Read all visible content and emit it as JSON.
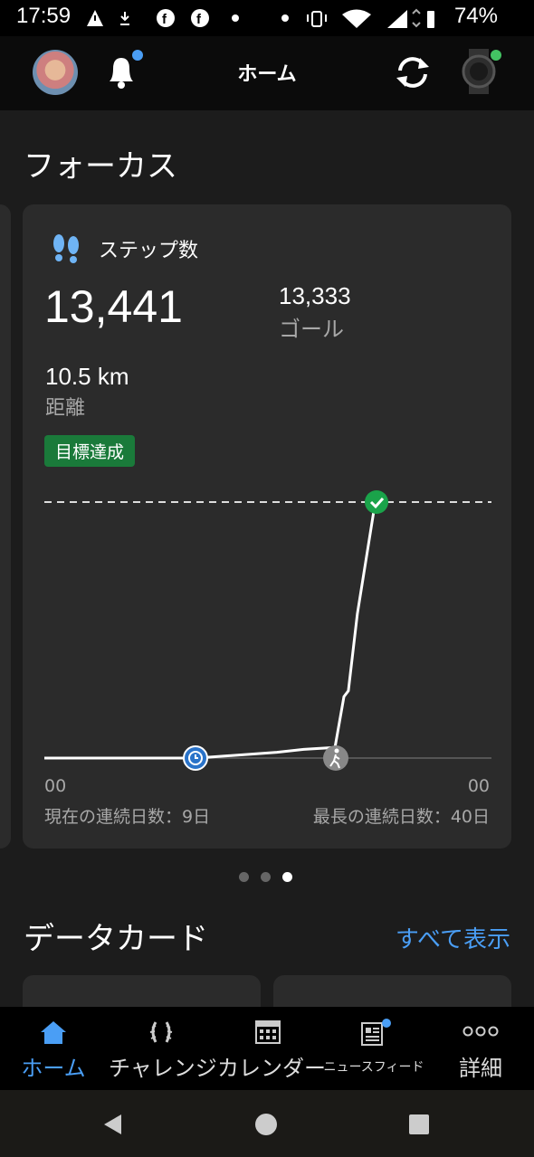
{
  "status_bar": {
    "time": "17:59",
    "battery": "74%"
  },
  "header": {
    "title": "ホーム"
  },
  "focus": {
    "section_title": "フォーカス",
    "card": {
      "title": "ステップ数",
      "steps": "13,441",
      "goal_value": "13,333",
      "goal_label": "ゴール",
      "distance_value": "10.5 km",
      "distance_label": "距離",
      "badge": "目標達成",
      "chart_x_start": "00",
      "chart_x_end": "00",
      "current_streak": "現在の連続日数：9日",
      "longest_streak": "最長の連続日数：40日"
    },
    "pager": {
      "count": 3,
      "active": 3
    }
  },
  "data_cards": {
    "section_title": "データカード",
    "view_all": "すべて表示"
  },
  "bottom_nav": {
    "items": [
      {
        "label": "ホーム",
        "icon": "home-icon",
        "active": true
      },
      {
        "label": "チャレンジ",
        "icon": "laurel-icon",
        "active": false
      },
      {
        "label": "カレンダー",
        "icon": "calendar-icon",
        "active": false
      },
      {
        "label": "ニュースフィード",
        "icon": "newsfeed-icon",
        "active": false
      },
      {
        "label": "詳細",
        "icon": "more-icon",
        "active": false
      }
    ]
  },
  "colors": {
    "accent": "#4a9ef5",
    "success": "#1a7a3a",
    "card_bg": "#2b2b2b",
    "page_bg": "#1c1c1c"
  },
  "chart_data": {
    "type": "line",
    "title": "",
    "x_tick_labels": [
      "00",
      "00"
    ],
    "goal": 13333,
    "ylim": [
      0,
      13333
    ],
    "series": [
      {
        "points": [
          [
            0,
            0
          ],
          [
            0.34,
            0
          ],
          [
            0.4,
            100
          ],
          [
            0.52,
            300
          ],
          [
            0.58,
            450
          ],
          [
            0.65,
            550
          ],
          [
            0.67,
            3200
          ],
          [
            0.68,
            3500
          ],
          [
            0.7,
            7500
          ],
          [
            0.74,
            13441
          ]
        ]
      }
    ],
    "markers": [
      "clock-icon",
      "walk-icon",
      "check-icon"
    ]
  }
}
